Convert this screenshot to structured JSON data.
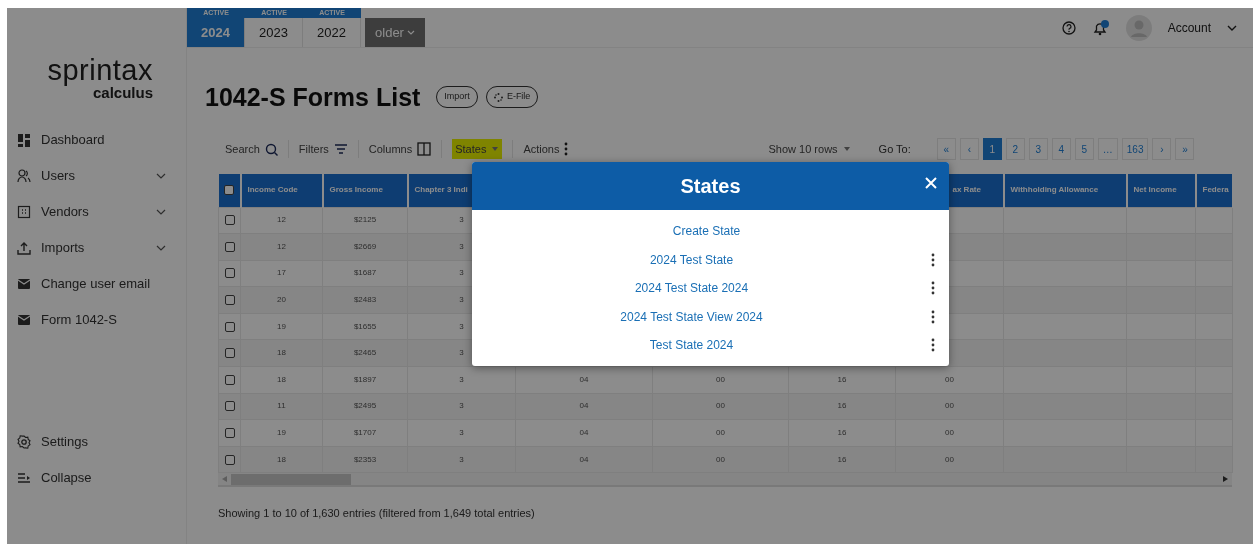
{
  "year_tabs": [
    {
      "badge": "ACTIVE",
      "label": "2024",
      "selected": true
    },
    {
      "badge": "ACTIVE",
      "label": "2023",
      "selected": false
    },
    {
      "badge": "ACTIVE",
      "label": "2022",
      "selected": false
    }
  ],
  "older_menu": {
    "label": "older"
  },
  "account": {
    "label": "Account"
  },
  "logo": {
    "name": "sprintax",
    "sub": "calculus"
  },
  "sidebar": {
    "items": [
      {
        "label": "Dashboard",
        "has_submenu": false
      },
      {
        "label": "Users",
        "has_submenu": true
      },
      {
        "label": "Vendors",
        "has_submenu": true
      },
      {
        "label": "Imports",
        "has_submenu": true
      },
      {
        "label": "Change user email",
        "has_submenu": false
      },
      {
        "label": "Form 1042-S",
        "has_submenu": false
      }
    ],
    "footer_items": [
      {
        "label": "Settings"
      },
      {
        "label": "Collapse"
      }
    ]
  },
  "page": {
    "title": "1042-S Forms List",
    "buttons": [
      {
        "label": "Import"
      },
      {
        "label": "E-File"
      }
    ]
  },
  "toolbar": {
    "items": [
      {
        "label": "Search",
        "highlighted": false
      },
      {
        "label": "Filters",
        "highlighted": false
      },
      {
        "label": "Columns",
        "highlighted": false
      },
      {
        "label": "States",
        "highlighted": true
      },
      {
        "label": "Actions",
        "highlighted": false
      }
    ],
    "rows_select": "Show 10 rows",
    "goto_label": "Go To:",
    "pagination": [
      {
        "label": "«",
        "selected": false
      },
      {
        "label": "‹",
        "selected": false
      },
      {
        "label": "1",
        "selected": true
      },
      {
        "label": "2",
        "selected": false
      },
      {
        "label": "3",
        "selected": false
      },
      {
        "label": "4",
        "selected": false
      },
      {
        "label": "5",
        "selected": false
      },
      {
        "label": "…",
        "selected": false
      },
      {
        "label": "163",
        "selected": false
      },
      {
        "label": "›",
        "selected": false
      },
      {
        "label": "»",
        "selected": false
      }
    ]
  },
  "table": {
    "select_all_checked": false,
    "columns": [
      "Income Code",
      "Gross Income",
      "Chapter 3 Indi",
      null,
      null,
      null,
      "ax Rate",
      "Withholding Allowance",
      "Net Income",
      "Federa"
    ],
    "rows": [
      {
        "checked": false,
        "cells": [
          "12",
          "$2125",
          "3",
          null,
          null,
          null,
          null,
          null,
          null,
          null
        ]
      },
      {
        "checked": false,
        "cells": [
          "12",
          "$2669",
          "3",
          null,
          null,
          null,
          null,
          null,
          null,
          null
        ]
      },
      {
        "checked": false,
        "cells": [
          "17",
          "$1687",
          "3",
          null,
          null,
          null,
          null,
          null,
          null,
          null
        ]
      },
      {
        "checked": false,
        "cells": [
          "20",
          "$2483",
          "3",
          null,
          null,
          null,
          null,
          null,
          null,
          null
        ]
      },
      {
        "checked": false,
        "cells": [
          "19",
          "$1655",
          "3",
          null,
          null,
          null,
          null,
          null,
          null,
          null
        ]
      },
      {
        "checked": false,
        "cells": [
          "18",
          "$2465",
          "3",
          null,
          null,
          null,
          null,
          null,
          null,
          null
        ]
      },
      {
        "checked": false,
        "cells": [
          "18",
          "$1897",
          "3",
          "04",
          "00",
          "16",
          "00",
          null,
          null,
          null
        ]
      },
      {
        "checked": false,
        "cells": [
          "11",
          "$2495",
          "3",
          "04",
          "00",
          "16",
          "00",
          null,
          null,
          null
        ]
      },
      {
        "checked": false,
        "cells": [
          "19",
          "$1707",
          "3",
          "04",
          "00",
          "16",
          "00",
          null,
          null,
          null
        ]
      },
      {
        "checked": false,
        "cells": [
          "18",
          "$2353",
          "3",
          "04",
          "00",
          "16",
          "00",
          null,
          null,
          null
        ]
      }
    ]
  },
  "footer": "Showing 1 to 10 of 1,630 entries (filtered from 1,649 total entries)",
  "modal": {
    "title": "States",
    "items": [
      {
        "kind": "create",
        "label": "Create State"
      },
      {
        "kind": "state",
        "label": "2024 Test State"
      },
      {
        "kind": "state",
        "label": "2024 Test State 2024"
      },
      {
        "kind": "state",
        "label": "2024 Test State View 2024"
      },
      {
        "kind": "state",
        "label": "Test State 2024"
      }
    ]
  }
}
